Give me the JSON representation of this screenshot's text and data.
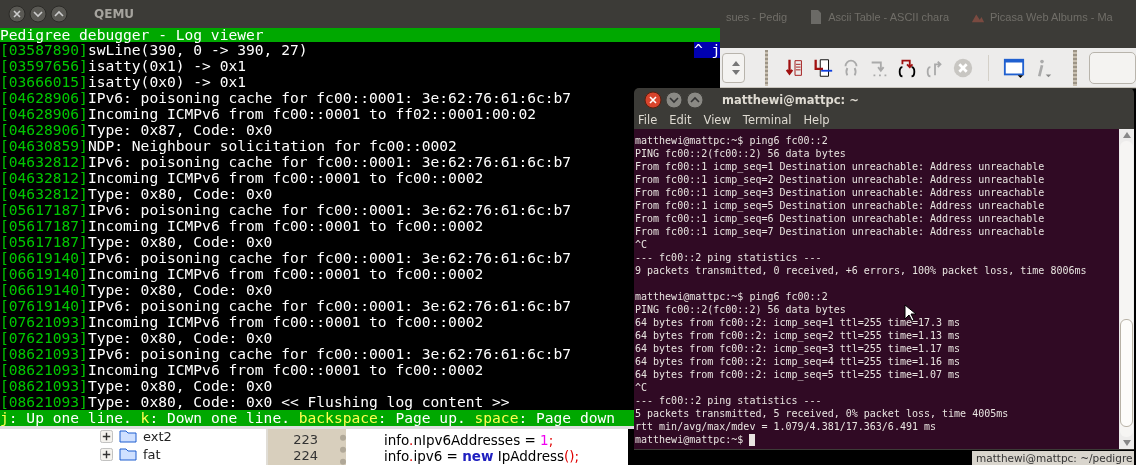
{
  "background_window": {
    "panel_tabs": [
      {
        "kind": "text",
        "label": "sues - Pedig"
      },
      {
        "kind": "document",
        "label": "Ascii Table - ASCII chara"
      },
      {
        "kind": "photos",
        "label": "Picasa Web Albums - Ma"
      }
    ],
    "toolbar": [
      {
        "kind": "run_to_cursor",
        "disabled": false
      },
      {
        "kind": "attach",
        "disabled": false
      },
      {
        "kind": "next_line",
        "disabled": true
      },
      {
        "kind": "next_instruction",
        "disabled": true
      },
      {
        "kind": "step_into",
        "disabled": false
      },
      {
        "kind": "step_out",
        "disabled": true
      },
      {
        "kind": "stop",
        "disabled": true
      },
      {
        "kind": "separator",
        "disabled": false
      },
      {
        "kind": "debug_windows",
        "disabled": false
      },
      {
        "kind": "info",
        "disabled": true
      }
    ],
    "tree": [
      {
        "label": "ext2",
        "expanded": false
      },
      {
        "label": "fat",
        "expanded": false
      }
    ],
    "code_lines": [
      {
        "number": "223",
        "tokens": [
          {
            "kind": "plain",
            "text": "info"
          },
          {
            "kind": "punct",
            "text": "."
          },
          {
            "kind": "plain",
            "text": "nIpv6Addresses = "
          },
          {
            "kind": "number",
            "text": "1"
          },
          {
            "kind": "punct",
            "text": ";"
          }
        ]
      },
      {
        "number": "224",
        "tokens": [
          {
            "kind": "plain",
            "text": "info"
          },
          {
            "kind": "punct",
            "text": "."
          },
          {
            "kind": "plain",
            "text": "ipv6 = "
          },
          {
            "kind": "keyword",
            "text": "new"
          },
          {
            "kind": "plain",
            "text": " IpAddress"
          },
          {
            "kind": "punct",
            "text": "();"
          }
        ]
      }
    ],
    "taskbar_button": "matthewi@mattpc: ~/pedigre"
  },
  "qemu_window": {
    "title": "QEMU",
    "header": "Pedigree debugger - Log viewer",
    "scroll_hint": "^ j",
    "log_lines": [
      {
        "timestamp": "[03587890]",
        "message": "swLine(390, 0 -> 390, 27)"
      },
      {
        "timestamp": "[03597656]",
        "message": "isatty(0x1) -> 0x1"
      },
      {
        "timestamp": "[03666015]",
        "message": "isatty(0x0) -> 0x1"
      },
      {
        "timestamp": "[04628906]",
        "message": "IPv6: poisoning cache for fc00::0001: 3e:62:76:61:6c:b7"
      },
      {
        "timestamp": "[04628906]",
        "message": "Incoming ICMPv6 from fc00::0001 to ff02::0001:00:02"
      },
      {
        "timestamp": "[04628906]",
        "message": "Type: 0x87, Code: 0x0"
      },
      {
        "timestamp": "[04630859]",
        "message": "NDP: Neighbour solicitation for fc00::0002"
      },
      {
        "timestamp": "[04632812]",
        "message": "IPv6: poisoning cache for fc00::0001: 3e:62:76:61:6c:b7"
      },
      {
        "timestamp": "[04632812]",
        "message": "Incoming ICMPv6 from fc00::0001 to fc00::0002"
      },
      {
        "timestamp": "[04632812]",
        "message": "Type: 0x80, Code: 0x0"
      },
      {
        "timestamp": "[05617187]",
        "message": "IPv6: poisoning cache for fc00::0001: 3e:62:76:61:6c:b7"
      },
      {
        "timestamp": "[05617187]",
        "message": "Incoming ICMPv6 from fc00::0001 to fc00::0002"
      },
      {
        "timestamp": "[05617187]",
        "message": "Type: 0x80, Code: 0x0"
      },
      {
        "timestamp": "[06619140]",
        "message": "IPv6: poisoning cache for fc00::0001: 3e:62:76:61:6c:b7"
      },
      {
        "timestamp": "[06619140]",
        "message": "Incoming ICMPv6 from fc00::0001 to fc00::0002"
      },
      {
        "timestamp": "[06619140]",
        "message": "Type: 0x80, Code: 0x0"
      },
      {
        "timestamp": "[07619140]",
        "message": "IPv6: poisoning cache for fc00::0001: 3e:62:76:61:6c:b7"
      },
      {
        "timestamp": "[07621093]",
        "message": "Incoming ICMPv6 from fc00::0001 to fc00::0002"
      },
      {
        "timestamp": "[07621093]",
        "message": "Type: 0x80, Code: 0x0"
      },
      {
        "timestamp": "[08621093]",
        "message": "IPv6: poisoning cache for fc00::0001: 3e:62:76:61:6c:b7"
      },
      {
        "timestamp": "[08621093]",
        "message": "Incoming ICMPv6 from fc00::0001 to fc00::0002"
      },
      {
        "timestamp": "[08621093]",
        "message": "Type: 0x80, Code: 0x0"
      },
      {
        "timestamp": "[08621093]",
        "message": "Type: 0x80, Code: 0x0 << Flushing log content >>"
      }
    ],
    "help_bar": [
      {
        "key": "j",
        "text": ": Up one line. "
      },
      {
        "key": "k",
        "text": ": Down one line. "
      },
      {
        "key": "backspace",
        "text": ": Page up. "
      },
      {
        "key": "space",
        "text": ": Page down"
      }
    ]
  },
  "terminal_window": {
    "title": "matthewi@mattpc: ~",
    "menu": [
      "File",
      "Edit",
      "View",
      "Terminal",
      "Help"
    ],
    "sessions": [
      {
        "lines": [
          "matthewi@mattpc:~$ ping6 fc00::2",
          "PING fc00::2(fc00::2) 56 data bytes",
          "From fc00::1 icmp_seq=1 Destination unreachable: Address unreachable",
          "From fc00::1 icmp_seq=2 Destination unreachable: Address unreachable",
          "From fc00::1 icmp_seq=3 Destination unreachable: Address unreachable",
          "From fc00::1 icmp_seq=5 Destination unreachable: Address unreachable",
          "From fc00::1 icmp_seq=6 Destination unreachable: Address unreachable",
          "From fc00::1 icmp_seq=7 Destination unreachable: Address unreachable",
          "^C",
          "--- fc00::2 ping statistics ---",
          "9 packets transmitted, 0 received, +6 errors, 100% packet loss, time 8006ms"
        ]
      },
      {
        "lines": [
          "matthewi@mattpc:~$ ping6 fc00::2",
          "PING fc00::2(fc00::2) 56 data bytes",
          "64 bytes from fc00::2: icmp_seq=1 ttl=255 time=17.3 ms",
          "64 bytes from fc00::2: icmp_seq=2 ttl=255 time=1.13 ms",
          "64 bytes from fc00::2: icmp_seq=3 ttl=255 time=1.17 ms",
          "64 bytes from fc00::2: icmp_seq=4 ttl=255 time=1.16 ms",
          "64 bytes from fc00::2: icmp_seq=5 ttl=255 time=1.07 ms",
          "^C",
          "--- fc00::2 ping statistics ---",
          "5 packets transmitted, 5 received, 0% packet loss, time 4005ms",
          "rtt min/avg/max/mdev = 1.079/4.381/17.363/6.491 ms"
        ]
      }
    ],
    "prompt": "matthewi@mattpc:~$"
  }
}
